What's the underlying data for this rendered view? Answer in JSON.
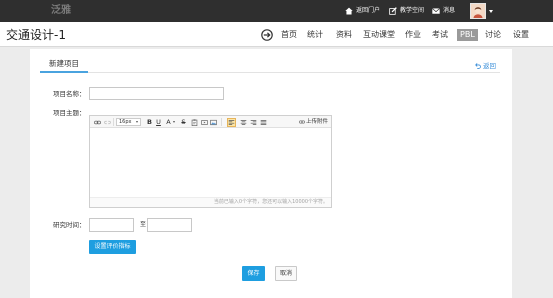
{
  "header": {
    "logo": "泛雅",
    "portal_link": {
      "label": "返回门户",
      "icon": "home-icon"
    },
    "teaching_link": {
      "label": "教学空间",
      "icon": "edit-icon"
    },
    "message_link": {
      "label": "消息",
      "icon": "mail-icon"
    },
    "user_menu": {
      "avatar_icon": "user-avatar-icon",
      "menu_icon": "caret-down-icon"
    }
  },
  "course": {
    "title": "交通设计-1",
    "nav_icon": "circle-arrow-right-icon",
    "nav": [
      {
        "label": "首页",
        "active": false
      },
      {
        "label": "统计",
        "active": false
      },
      {
        "label": "资料",
        "active": false
      },
      {
        "label": "互动课堂",
        "active": false
      },
      {
        "label": "作业",
        "active": false
      },
      {
        "label": "考试",
        "active": false
      },
      {
        "label": "PBL",
        "active": true
      },
      {
        "label": "讨论",
        "active": false
      },
      {
        "label": "设置",
        "active": false
      }
    ]
  },
  "tabs": [
    {
      "label": "新建项目",
      "active": true
    }
  ],
  "back_link": {
    "label": "返回",
    "icon": "return-icon"
  },
  "form": {
    "name": {
      "label": "项目名称：",
      "value": ""
    },
    "topic": {
      "label": "项目主题：",
      "editor": {
        "toolbar": {
          "link_icon": "link-icon",
          "unlink_icon": "unlink-icon",
          "size_select": "16px",
          "bold": "B",
          "underline": "U",
          "font_color": "A",
          "strikethrough": "S",
          "paste_icon": "paste-text-icon",
          "video_icon": "insert-video-icon",
          "image_icon": "insert-image-icon",
          "align_icons": [
            "align-left-icon",
            "align-center-icon",
            "align-right-icon",
            "align-justify-icon"
          ],
          "align_left_active": true,
          "upload_icon": "attachment-icon",
          "upload_label": "上传附件"
        },
        "content": "",
        "counter": "当前已输入0个字符，您还可以输入10000个字符。"
      }
    },
    "period": {
      "label": "研究时间：",
      "start": "",
      "separator": "至",
      "end": ""
    },
    "criteria_button": "设置评价指标"
  },
  "actions": {
    "save": "保存",
    "cancel": "取消"
  },
  "colors": {
    "header_bg": "#2f2f2f",
    "accent": "#1e9ee0",
    "link_blue": "#3b8fd9",
    "active_nav_bg": "#9a9a9a",
    "page_bg": "#ececec"
  }
}
